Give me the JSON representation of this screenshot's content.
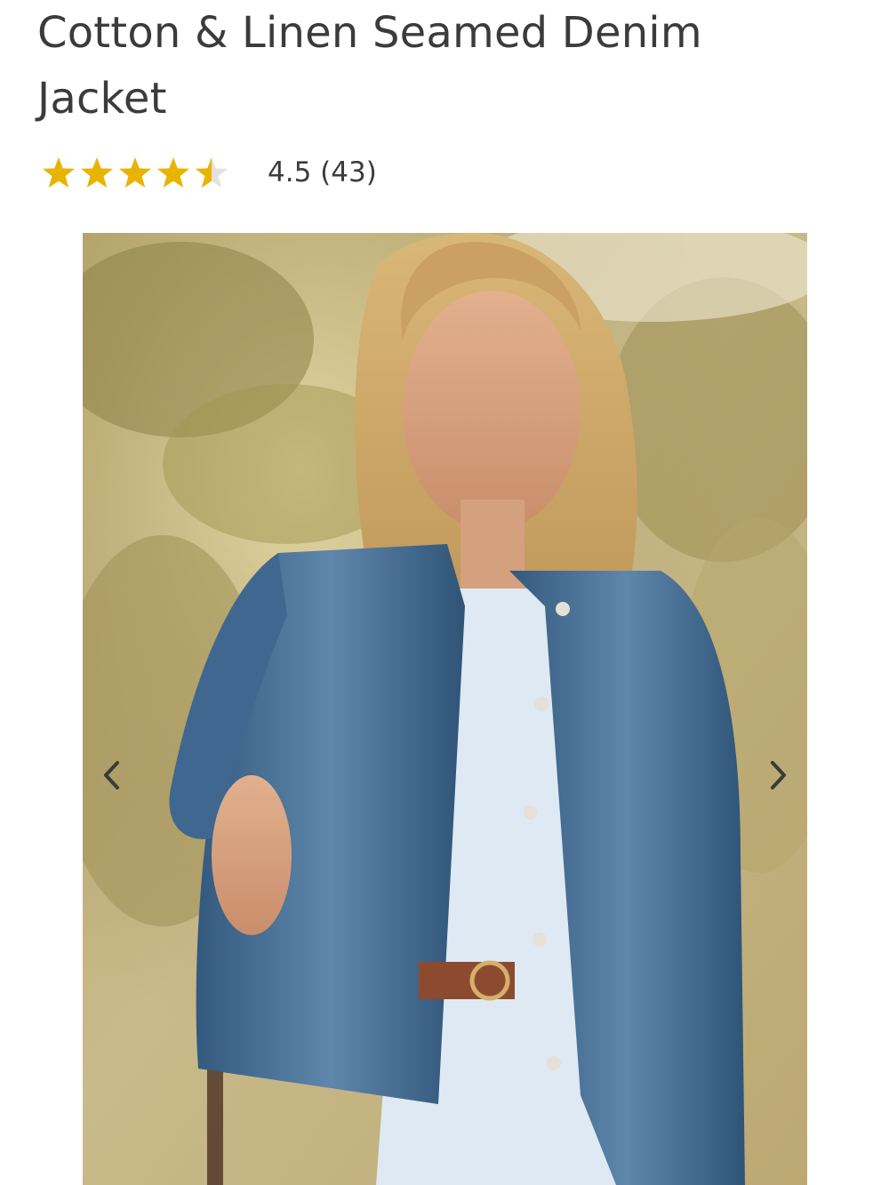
{
  "product": {
    "title": "Cotton & Linen Seamed Denim Jacket",
    "rating": {
      "value": 4.5,
      "max": 5,
      "text": "4.5 (43)",
      "star_color": "#e8b400",
      "empty_star_color": "#e2e2e2"
    }
  },
  "gallery": {
    "image_alt": "Woman wearing a blue denim jacket outdoors",
    "prev_icon": "chevron-left-icon",
    "next_icon": "chevron-right-icon"
  }
}
